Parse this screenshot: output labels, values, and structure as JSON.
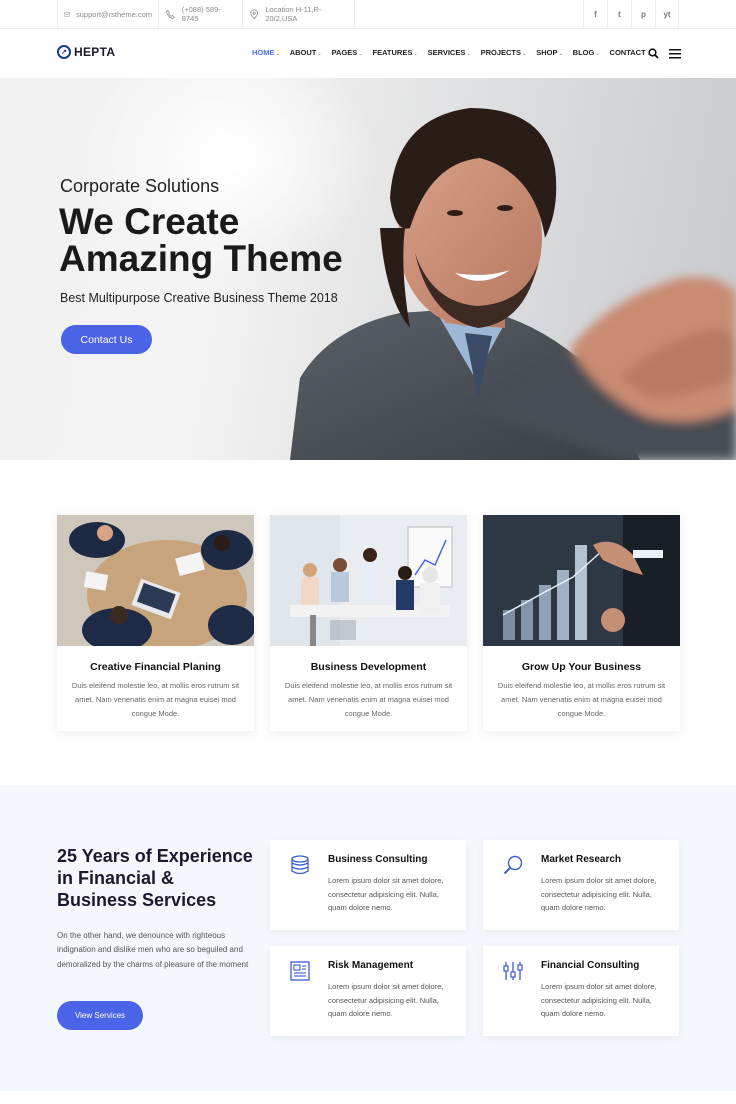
{
  "topbar": {
    "email": "support@rstheme.com",
    "phone": "(+088) 589-8745",
    "location": "Location H-11,R-20/2,USA",
    "socials": [
      "f",
      "t",
      "p",
      "yt"
    ]
  },
  "header": {
    "logo_text": "HEPTA",
    "nav": [
      {
        "label": "HOME"
      },
      {
        "label": "ABOUT"
      },
      {
        "label": "PAGES"
      },
      {
        "label": "FEATURES"
      },
      {
        "label": "SERVICES"
      },
      {
        "label": "PROJECTS"
      },
      {
        "label": "SHOP"
      },
      {
        "label": "BLOG"
      },
      {
        "label": "CONTACT"
      }
    ]
  },
  "hero": {
    "subtitle": "Corporate Solutions",
    "title_line1": "We Create",
    "title_line2": "Amazing Theme",
    "tagline": "Best Multipurpose Creative Business Theme 2018",
    "button": "Contact Us"
  },
  "features": [
    {
      "title": "Creative Financial Planing",
      "text": "Duis eleifend molestie leo, at mollis eros rutrum sit amet. Nam venenatis enim at magna euisei mod congue Mode."
    },
    {
      "title": "Business Development",
      "text": "Duis eleifend molestie leo, at mollis eros rutrum sit amet. Nam venenatis enim at magna euisei mod congue Mode."
    },
    {
      "title": "Grow Up Your Business",
      "text": "Duis eleifend molestie leo, at mollis eros rutrum sit amet. Nam venenatis enim at magna euisei mod congue Mode."
    }
  ],
  "experience": {
    "title": "25 Years of Experience in Financial & Business Services",
    "description": "On the other hand, we denounce with righteous indignation and dislike men who are so beguiled and demoralized by the charms of pleasure of the moment",
    "button": "View Services"
  },
  "services": [
    {
      "title": "Business Consulting",
      "text": "Lorem ipsum dolor sit amet dolore, consectetur adipisicing elit. Nulla, quam dolore nemo.",
      "icon": "database-icon"
    },
    {
      "title": "Market Research",
      "text": "Lorem ipsum dolor sit amet dolore, consectetur adipisicing elit. Nulla, quam dolore nemo.",
      "icon": "magnifier-icon"
    },
    {
      "title": "Risk Management",
      "text": "Lorem ipsum dolor sit amet dolore, consectetur adipisicing elit. Nulla, quam dolore nemo.",
      "icon": "document-icon"
    },
    {
      "title": "Financial Consulting",
      "text": "Lorem ipsum dolor sit amet dolore, consectetur adipisicing elit. Nulla, quam dolore nemo.",
      "icon": "sliders-icon"
    }
  ],
  "colors": {
    "accent": "#4a63e7",
    "nav_active": "#4a6cf7",
    "section_bg": "#f4f7fc"
  }
}
